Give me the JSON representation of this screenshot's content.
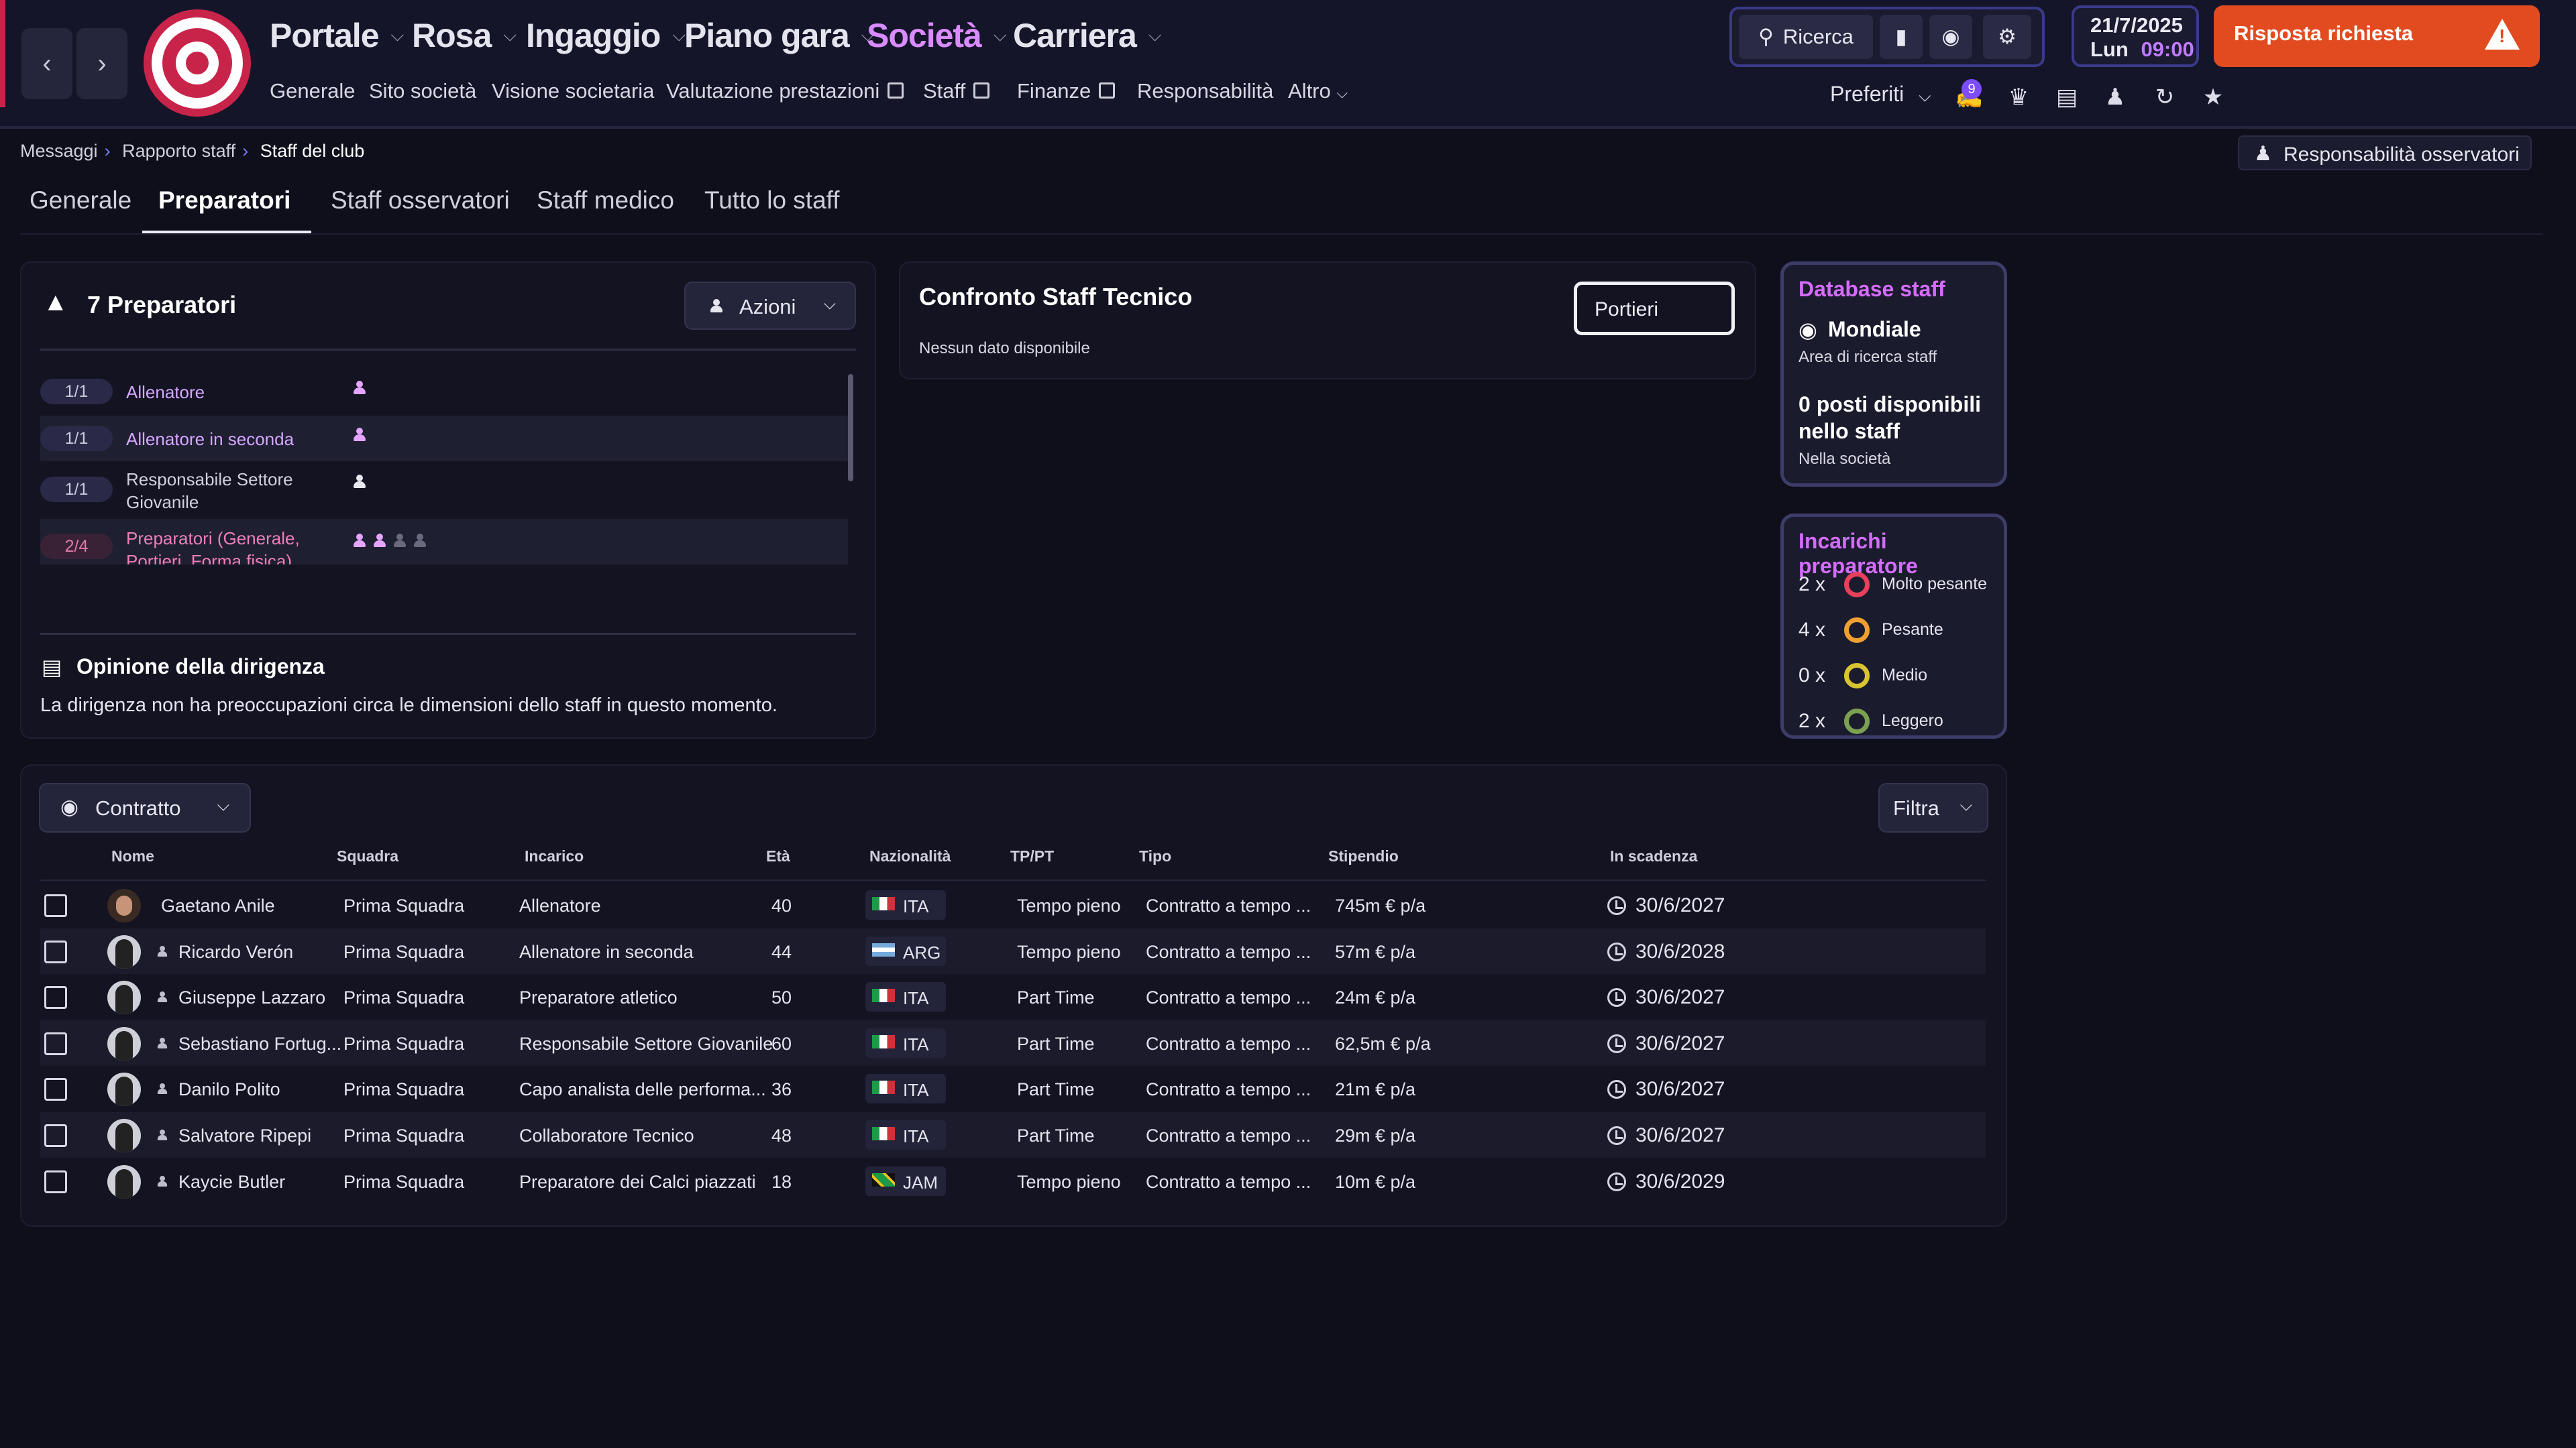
{
  "nav": {
    "back": "<",
    "forward": ">",
    "items": [
      "Portale",
      "Rosa",
      "Ingaggio",
      "Piano gara",
      "Società",
      "Carriera"
    ],
    "active": "Società",
    "sub": [
      "Generale",
      "Sito società",
      "Visione societaria",
      "Valutazione prestazioni",
      "Staff",
      "Finanze",
      "Responsabilità",
      "Altro"
    ]
  },
  "toolbar": {
    "search": "Ricerca",
    "date": "21/7/2025",
    "day": "Lun",
    "time": "09:00",
    "alert": "Risposta richiesta",
    "favorites": "Preferiti",
    "badge": "9"
  },
  "breadcrumb": [
    "Messaggi",
    "Rapporto staff",
    "Staff del club"
  ],
  "scout_resp": "Responsabilità osservatori",
  "tabs": [
    "Generale",
    "Preparatori",
    "Staff osservatori",
    "Staff medico",
    "Tutto lo staff"
  ],
  "active_tab": "Preparatori",
  "coaches_panel": {
    "title": "7 Preparatori",
    "actions": "Azioni",
    "roles": [
      {
        "count": "1/1",
        "label": "Allenatore",
        "filled": 1,
        "empty": 0
      },
      {
        "count": "1/1",
        "label": "Allenatore in seconda",
        "filled": 1,
        "empty": 0
      },
      {
        "count": "1/1",
        "label": "Responsabile Settore",
        "label2": "Giovanile",
        "filled": 1,
        "empty": 0
      },
      {
        "count": "2/4",
        "label": "Preparatori (Generale,",
        "label2": "Portieri, Forma fisica)",
        "filled": 2,
        "empty": 2
      }
    ],
    "opinion_title": "Opinione della dirigenza",
    "opinion_text": "La dirigenza non ha preoccupazioni circa le dimensioni dello staff in questo momento."
  },
  "compare": {
    "title": "Confronto Staff Tecnico",
    "select": "Portieri",
    "empty": "Nessun dato disponibile"
  },
  "database": {
    "title": "Database staff",
    "scope": "Mondiale",
    "scope_sub": "Area di ricerca staff",
    "slots": "0 posti disponibili",
    "slots2": "nello staff",
    "slots_sub": "Nella società"
  },
  "workload": {
    "title": "Incarichi preparatore",
    "items": [
      {
        "count": "2 x",
        "label": "Molto pesante",
        "color": "#e8405a"
      },
      {
        "count": "4 x",
        "label": "Pesante",
        "color": "#f0a030"
      },
      {
        "count": "0 x",
        "label": "Medio",
        "color": "#d8c430"
      },
      {
        "count": "2 x",
        "label": "Leggero",
        "color": "#7aa050"
      }
    ]
  },
  "table": {
    "view": "Contratto",
    "filter": "Filtra",
    "headers": [
      "Nome",
      "Squadra",
      "Incarico",
      "Età",
      "Nazionalità",
      "TP/PT",
      "Tipo",
      "Stipendio",
      "In scadenza"
    ],
    "rows": [
      {
        "name": "Gaetano Anile",
        "team": "Prima Squadra",
        "role": "Allenatore",
        "age": "40",
        "nat": "ITA",
        "tp": "Tempo pieno",
        "type": "Contratto a tempo ...",
        "wage": "745m € p/a",
        "exp": "30/6/2027"
      },
      {
        "name": "Ricardo Verón",
        "team": "Prima Squadra",
        "role": "Allenatore in seconda",
        "age": "44",
        "nat": "ARG",
        "tp": "Tempo pieno",
        "type": "Contratto a tempo ...",
        "wage": "57m € p/a",
        "exp": "30/6/2028"
      },
      {
        "name": "Giuseppe Lazzaro",
        "team": "Prima Squadra",
        "role": "Preparatore atletico",
        "age": "50",
        "nat": "ITA",
        "tp": "Part Time",
        "type": "Contratto a tempo ...",
        "wage": "24m € p/a",
        "exp": "30/6/2027"
      },
      {
        "name": "Sebastiano Fortug...",
        "team": "Prima Squadra",
        "role": "Responsabile Settore Giovanile",
        "age": "60",
        "nat": "ITA",
        "tp": "Part Time",
        "type": "Contratto a tempo ...",
        "wage": "62,5m € p/a",
        "exp": "30/6/2027"
      },
      {
        "name": "Danilo Polito",
        "team": "Prima Squadra",
        "role": "Capo analista delle performa...",
        "age": "36",
        "nat": "ITA",
        "tp": "Part Time",
        "type": "Contratto a tempo ...",
        "wage": "21m € p/a",
        "exp": "30/6/2027"
      },
      {
        "name": "Salvatore Ripepi",
        "team": "Prima Squadra",
        "role": "Collaboratore Tecnico",
        "age": "48",
        "nat": "ITA",
        "tp": "Part Time",
        "type": "Contratto a tempo ...",
        "wage": "29m € p/a",
        "exp": "30/6/2027"
      },
      {
        "name": "Kaycie Butler",
        "team": "Prima Squadra",
        "role": "Preparatore dei Calci piazzati",
        "age": "18",
        "nat": "JAM",
        "tp": "Tempo pieno",
        "type": "Contratto a tempo ...",
        "wage": "10m € p/a",
        "exp": "30/6/2029"
      }
    ]
  }
}
